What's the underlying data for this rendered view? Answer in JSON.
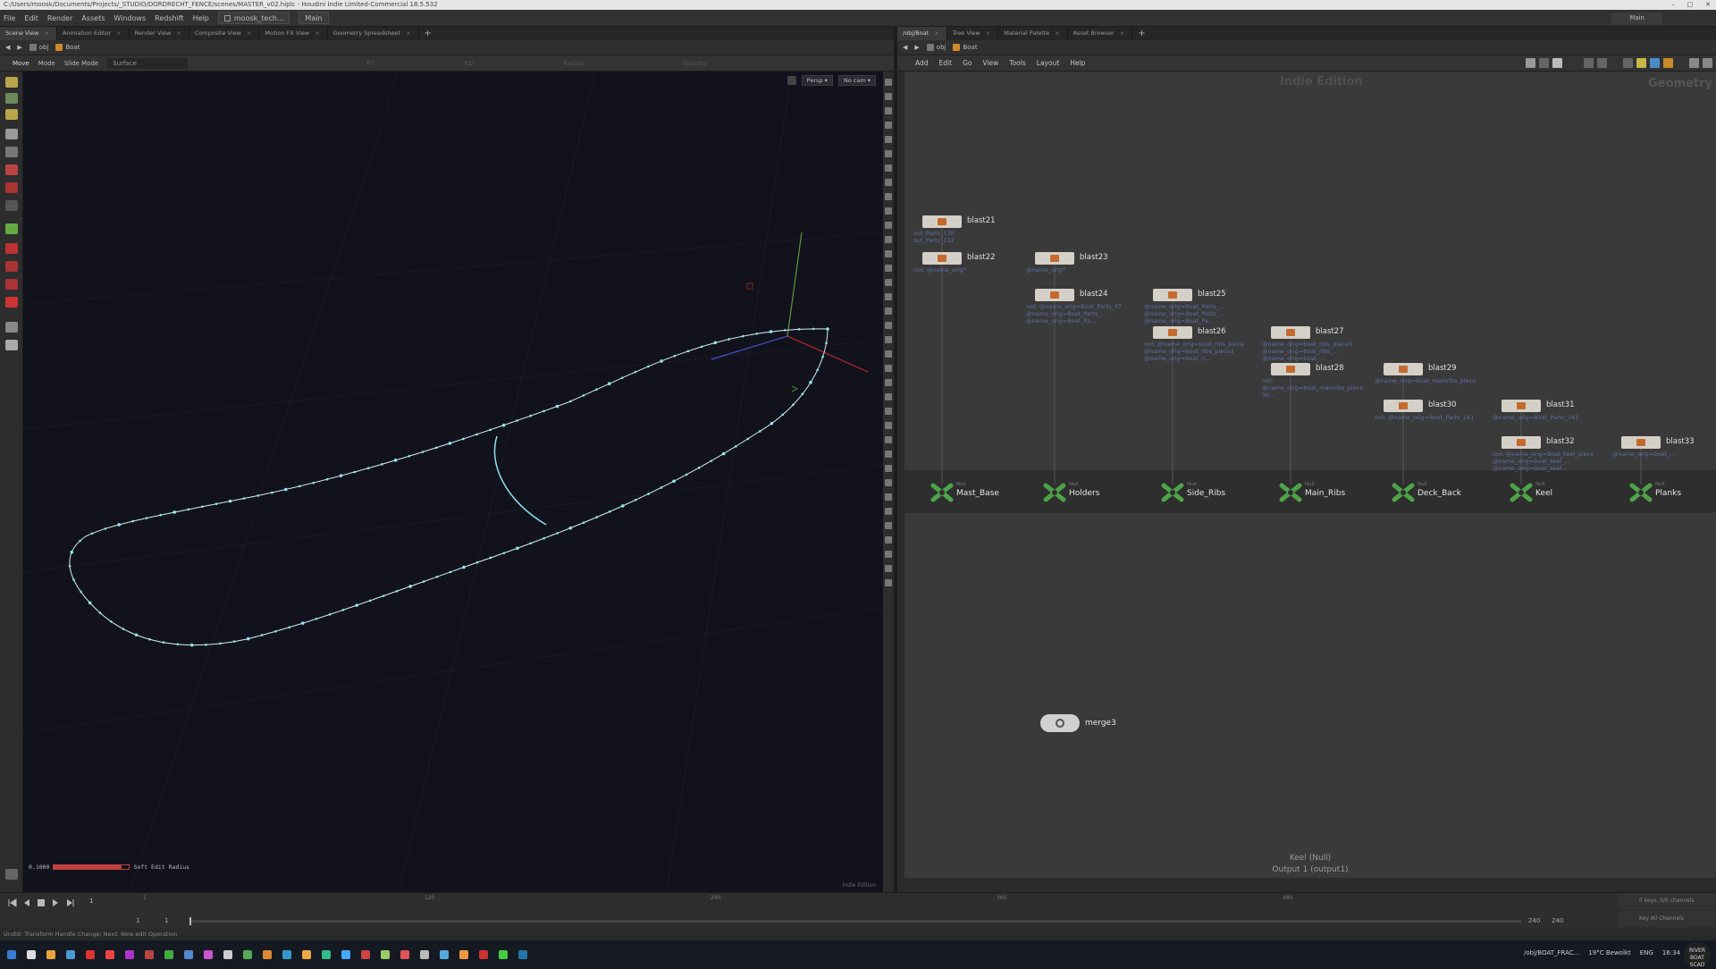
{
  "window": {
    "title": "C:/Users/moosk/Documents/Projects/_STUDIO/DORDRECHT_FENCE/scenes/MASTER_v02.hiplc - Houdini Indie Limited-Commercial 18.5.532"
  },
  "menubar": {
    "items": [
      "File",
      "Edit",
      "Render",
      "Assets",
      "Windows",
      "Redshift",
      "Help"
    ],
    "desktop": "moosk_tech...",
    "desktop2": "Main",
    "right_workspace": "Main"
  },
  "left_pane": {
    "tabs": [
      {
        "label": "Scene View",
        "active": true
      },
      {
        "label": "Animation Editor",
        "active": false
      },
      {
        "label": "Render View",
        "active": false
      },
      {
        "label": "Composite View",
        "active": false
      },
      {
        "label": "Motion FX View",
        "active": false
      },
      {
        "label": "Geometry Spreadsheet",
        "active": false
      }
    ],
    "path": {
      "root": "obj",
      "node": "Boat"
    },
    "tool_options": {
      "tool": "Move",
      "mode": "Mode",
      "slide_mode": "Slide Mode",
      "surface": "Surface",
      "fill": "Fill",
      "rad": "RD",
      "radius": "Radius",
      "opacity": "Opacity"
    },
    "viewport": {
      "persp_button": "Persp ▾",
      "cam_button": "No cam ▾",
      "soft_edit_value": "0.1000",
      "soft_edit_label": "Soft Edit Radius",
      "soft_edit_fraction": 0.9,
      "edition_label": "Indie Edition",
      "bg_color": "#12121d",
      "curve_color": "#8fe6f0"
    }
  },
  "right_pane": {
    "tabs": [
      {
        "label": "/obj/Boat",
        "active": true
      },
      {
        "label": "Tree View",
        "active": false
      },
      {
        "label": "Material Palette",
        "active": false
      },
      {
        "label": "Asset Browser",
        "active": false
      }
    ],
    "path": {
      "root": "obj",
      "node": "Boat"
    },
    "menu": [
      "Add",
      "Edit",
      "Go",
      "View",
      "Tools",
      "Layout",
      "Help"
    ],
    "context_label": "Geometry",
    "ghost_label": "Indie Edition",
    "blast_nodes": [
      {
        "name": "blast21",
        "group": "out_Parts_130\nout_Parts_132"
      },
      {
        "name": "blast22",
        "group": "not: @name_orig*"
      },
      {
        "name": "blast23",
        "group": "@name_orig*"
      },
      {
        "name": "blast24",
        "group": "not: @name_orig=Boat_Parts_37\n@name_orig=Boat_Parts_...\n@name_orig=Boat_Pa..."
      },
      {
        "name": "blast25",
        "group": "@name_orig=Boat_Parts_...\n@name_orig=Boat_Parts_...\n@name_orig=Boat_Pa..."
      },
      {
        "name": "blast26",
        "group": "not: @name_orig=boat_ribs_piece\n@name_orig=boat_ribs_piece1\n@name_orig=boat_ri..."
      },
      {
        "name": "blast27",
        "group": "@name_orig=boat_ribs_piece0\n@name_orig=boat_ribs_...\n@name_orig=boat_..."
      },
      {
        "name": "blast28",
        "group": "not:\n@name_orig=boat_mainribs_piece\n30..."
      },
      {
        "name": "blast29",
        "group": "@name_orig=boat_mainribs_piece"
      },
      {
        "name": "blast30",
        "group": "not: @name_orig=Boat_Parts_141"
      },
      {
        "name": "blast31",
        "group": "@name_orig=Boat_Parts_141"
      },
      {
        "name": "blast32",
        "group": "not: @name_orig=boat_keel_piece\n@name_orig=boat_keel_...\n@name_orig=boat_keel..."
      },
      {
        "name": "blast33",
        "group": "@name_orig=boat_..."
      }
    ],
    "null_nodes": [
      {
        "type": "Null",
        "name": "Mast_Base"
      },
      {
        "type": "Null",
        "name": "Holders"
      },
      {
        "type": "Null",
        "name": "Side_Ribs"
      },
      {
        "type": "Null",
        "name": "Main_Ribs"
      },
      {
        "type": "Null",
        "name": "Deck_Back"
      },
      {
        "type": "Null",
        "name": "Keel"
      },
      {
        "type": "Null",
        "name": "Planks"
      }
    ],
    "merge_node": {
      "name": "merge3"
    },
    "footer": {
      "node": "Keel (Null)",
      "output": "Output 1 (output1)"
    }
  },
  "timeline": {
    "frame": "1",
    "start": "1",
    "start2": "1",
    "end": "240",
    "end2": "240",
    "ticks": [
      "1",
      "120",
      "240",
      "360",
      "480"
    ],
    "keys_label": "0 keys, 0/0 channels",
    "key_all_label": "Key All Channels"
  },
  "status": {
    "message": "Undid: Transform Handle Change; Next: New edit Operation"
  },
  "taskbar": {
    "weather": "19°C  Bewolkt",
    "net_path": "/obj/BOAT_FRAC...",
    "lang": "ENG",
    "clock": "16:34",
    "watermark": "RIVER BOAT SCAD"
  }
}
